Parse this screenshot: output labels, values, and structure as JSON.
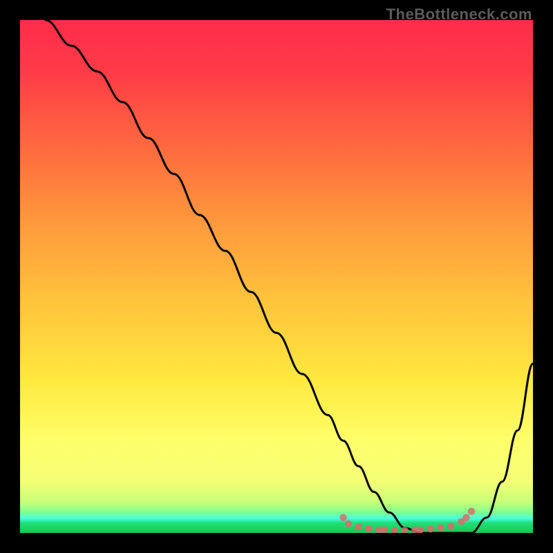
{
  "watermark": "TheBottleneck.com",
  "chart_data": {
    "type": "line",
    "title": "",
    "xlabel": "",
    "ylabel": "",
    "xlim": [
      0,
      100
    ],
    "ylim": [
      0,
      100
    ],
    "grid": false,
    "legend": false,
    "background_gradient": {
      "top_color": "#ff2c4b",
      "mid_colors": [
        "#ff8b3e",
        "#ffd23e",
        "#ffff6a",
        "#e6ff6a"
      ],
      "bottom_color": "#21e05a",
      "cyan_band": "#46ffe0"
    },
    "series": [
      {
        "name": "curve",
        "stroke": "#000000",
        "x": [
          5,
          10,
          15,
          20,
          25,
          30,
          35,
          40,
          45,
          50,
          55,
          60,
          63,
          66,
          69,
          72,
          75,
          78,
          80,
          82,
          85,
          88,
          91,
          94,
          97,
          100
        ],
        "y": [
          100,
          95,
          90,
          84,
          77,
          70,
          62,
          55,
          47,
          39,
          31,
          23,
          18,
          13,
          8,
          4,
          1,
          0,
          0,
          0,
          0,
          0,
          3,
          10,
          20,
          33
        ]
      },
      {
        "name": "dots",
        "type": "scatter",
        "stroke": "#d96b6b",
        "x": [
          63,
          64,
          66,
          68,
          70,
          71,
          73,
          75,
          77,
          78,
          80,
          82,
          84,
          86,
          87,
          88
        ],
        "y": [
          3,
          1.8,
          1.2,
          0.8,
          0.6,
          0.6,
          0.5,
          0.5,
          0.6,
          0.6,
          0.8,
          1.0,
          1.3,
          2.2,
          3.0,
          4.2
        ]
      }
    ]
  }
}
